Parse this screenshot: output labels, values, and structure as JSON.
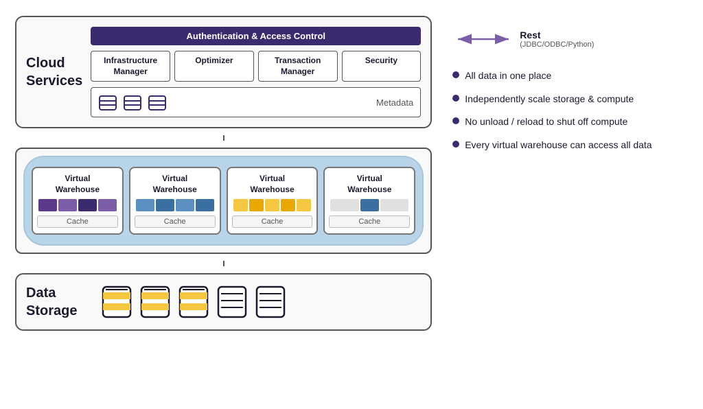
{
  "cloudServices": {
    "label": "Cloud\nServices",
    "authBar": "Authentication & Access Control",
    "managers": [
      {
        "label": "Infrastructure\nManager"
      },
      {
        "label": "Optimizer"
      },
      {
        "label": "Transaction\nManager"
      },
      {
        "label": "Security"
      }
    ],
    "metadataLabel": "Metadata"
  },
  "virtualWarehouses": {
    "sectionLabel": "Virtual Warehouse",
    "cards": [
      {
        "title": "Virtual\nWarehouse",
        "cacheLabel": "Cache",
        "colors": [
          "#5b3a8c",
          "#7b5ea7",
          "#3b2a6e",
          "#7b5ea7"
        ]
      },
      {
        "title": "Virtual\nWarehouse",
        "cacheLabel": "Cache",
        "colors": [
          "#5b90c0",
          "#3a70a0",
          "#5b90c0",
          "#3a70a0"
        ]
      },
      {
        "title": "Virtual\nWarehouse",
        "cacheLabel": "Cache",
        "colors": [
          "#f5c842",
          "#e8a800",
          "#f5c842",
          "#e8a800",
          "#f5c842"
        ]
      },
      {
        "title": "Virtual\nWarehouse",
        "cacheLabel": "Cache",
        "colors": [
          "#e0e0e0",
          "#3a70a0",
          "#e0e0e0"
        ]
      }
    ]
  },
  "dataStorage": {
    "label": "Data\nStorage",
    "cylinders": [
      {
        "hasGold": true
      },
      {
        "hasGold": true
      },
      {
        "hasGold": true
      },
      {
        "hasGold": false
      },
      {
        "hasGold": false
      }
    ]
  },
  "restApi": {
    "label": "Rest",
    "sublabel": "(JDBC/ODBC/Python)"
  },
  "bullets": [
    "All data in one place",
    "Independently scale storage & compute",
    "No unload / reload to shut off compute",
    "Every virtual warehouse can access all data"
  ]
}
